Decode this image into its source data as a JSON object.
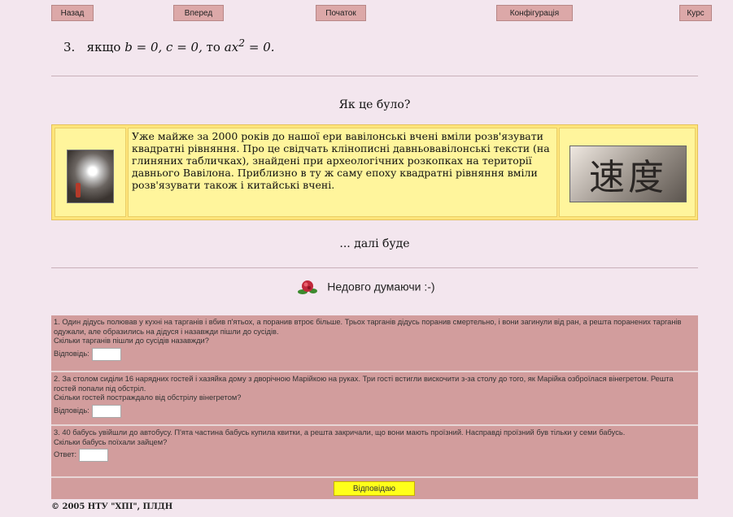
{
  "nav": {
    "back": "Назад",
    "forward": "Вперед",
    "start": "Початок",
    "config": "Конфігурація",
    "course": "Курс"
  },
  "formula": {
    "number": "3.",
    "if_word": "якщо",
    "cond": "b = 0, c = 0,",
    "then_word": "то",
    "result_base": "ax",
    "result_exp": "2",
    "result_tail": " = 0."
  },
  "history": {
    "heading": "Як це було?",
    "text": "Уже майже за 2000 років до нашої ери вавілонські вчені вміли розв'язувати квадратні рівняння. Про це свідчать клінописні давньовавілонські тексти (на глиняних табличках), знайдені при археологічних розкопках на території давнього Вавілона. Приблизно в ту ж саму епоху квадратні рівняння вміли розв'язувати також і китайські вчені.",
    "chars": "速度"
  },
  "continued": "... далі буде",
  "section_title": "Недовго думаючи :-)",
  "questions": [
    {
      "text": "1. Один дідусь полював у кухні на тарганів і вбив п'ятьох, а поранив втроє більше. Трьох тарганів дідусь поранив смертельно, і вони загинули від ран, а решта поранених тарганів одужали, але образились на дідуся і назавжди пішли до сусідів.",
      "ask": "Скільки тарганів пішли до сусідів назавжди?",
      "answer_label": "Відповідь:"
    },
    {
      "text": "2. За столом сиділи 16 нарядних гостей і хазяйка дому з дворічною Марійкою на руках. Три гості встигли вискочити з-за столу до того, як Марійка озброїлася вінегретом. Решта гостей попали під обстріл.",
      "ask": "Скільки гостей постраждало від обстрілу вінегретом?",
      "answer_label": "Відповідь:"
    },
    {
      "text": "3. 40 бабусь увійшли до автобусу. П'ята частина бабусь купила квитки, а решта закричали, що вони мають проїзний. Насправді проїзний був тільки у семи бабусь.",
      "ask": "Скільки бабусь поїхали зайцем?",
      "answer_label": "Ответ:"
    }
  ],
  "submit_label": "Відповідаю",
  "footer": "© 2005 НТУ \"ХПІ\", ПЛДН"
}
